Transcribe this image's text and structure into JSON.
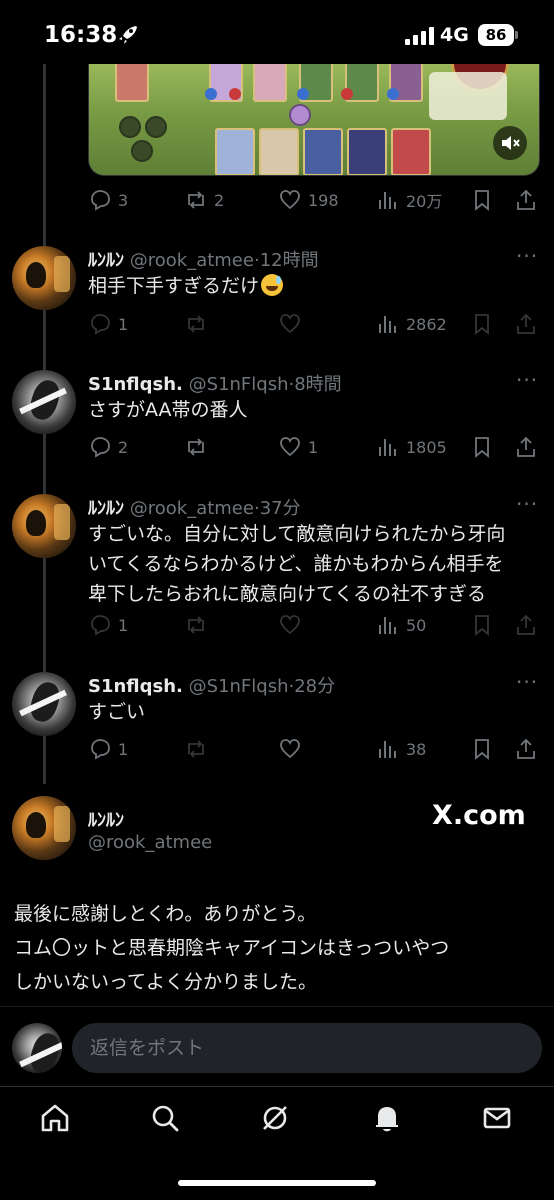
{
  "status": {
    "time": "16:38",
    "network": "4G",
    "battery": "86"
  },
  "thread_top": {
    "replies": "3",
    "reposts": "2",
    "likes": "198",
    "views": "20万"
  },
  "replies": [
    {
      "name": "ﾙﾝﾙﾝ",
      "handle": "@rook_atmee",
      "time": "12時間",
      "text": "相手下手すぎるだけ",
      "replies": "1",
      "reposts": "",
      "likes": "",
      "views": "2862"
    },
    {
      "name": "S1nflqsh.",
      "handle": "@S1nFlqsh",
      "time": "8時間",
      "text": "さすがAA帯の番人",
      "replies": "2",
      "reposts": "",
      "likes": "1",
      "views": "1805"
    },
    {
      "name": "ﾙﾝﾙﾝ",
      "handle": "@rook_atmee",
      "time": "37分",
      "lines": [
        "すごいな。自分に対して敵意向けられたから牙向",
        "いてくるならわかるけど、誰かもわからん相手を",
        "卑下したらおれに敵意向けてくるの社不すぎる"
      ],
      "replies": "1",
      "reposts": "",
      "likes": "",
      "views": "50"
    },
    {
      "name": "S1nflqsh.",
      "handle": "@S1nFlqsh",
      "time": "28分",
      "text": "すごい",
      "replies": "1",
      "reposts": "",
      "likes": "",
      "views": "38"
    }
  ],
  "main_post": {
    "name": "ﾙﾝﾙﾝ",
    "handle": "@rook_atmee",
    "brand": "X.com",
    "lines": [
      "最後に感謝しとくわ。ありがとう。",
      "コム〇ットと思春期陰キャアイコンはきっついやつ",
      "しかいないってよく分かりました。"
    ]
  },
  "reply_bar": {
    "placeholder": "返信をポスト"
  },
  "nav": [
    "home-icon",
    "search-icon",
    "grok-icon",
    "bell-icon",
    "mail-icon"
  ],
  "colors": {
    "bg": "#000000",
    "text": "#e7e9ea",
    "muted": "#71767b",
    "divider": "#2f3336"
  }
}
